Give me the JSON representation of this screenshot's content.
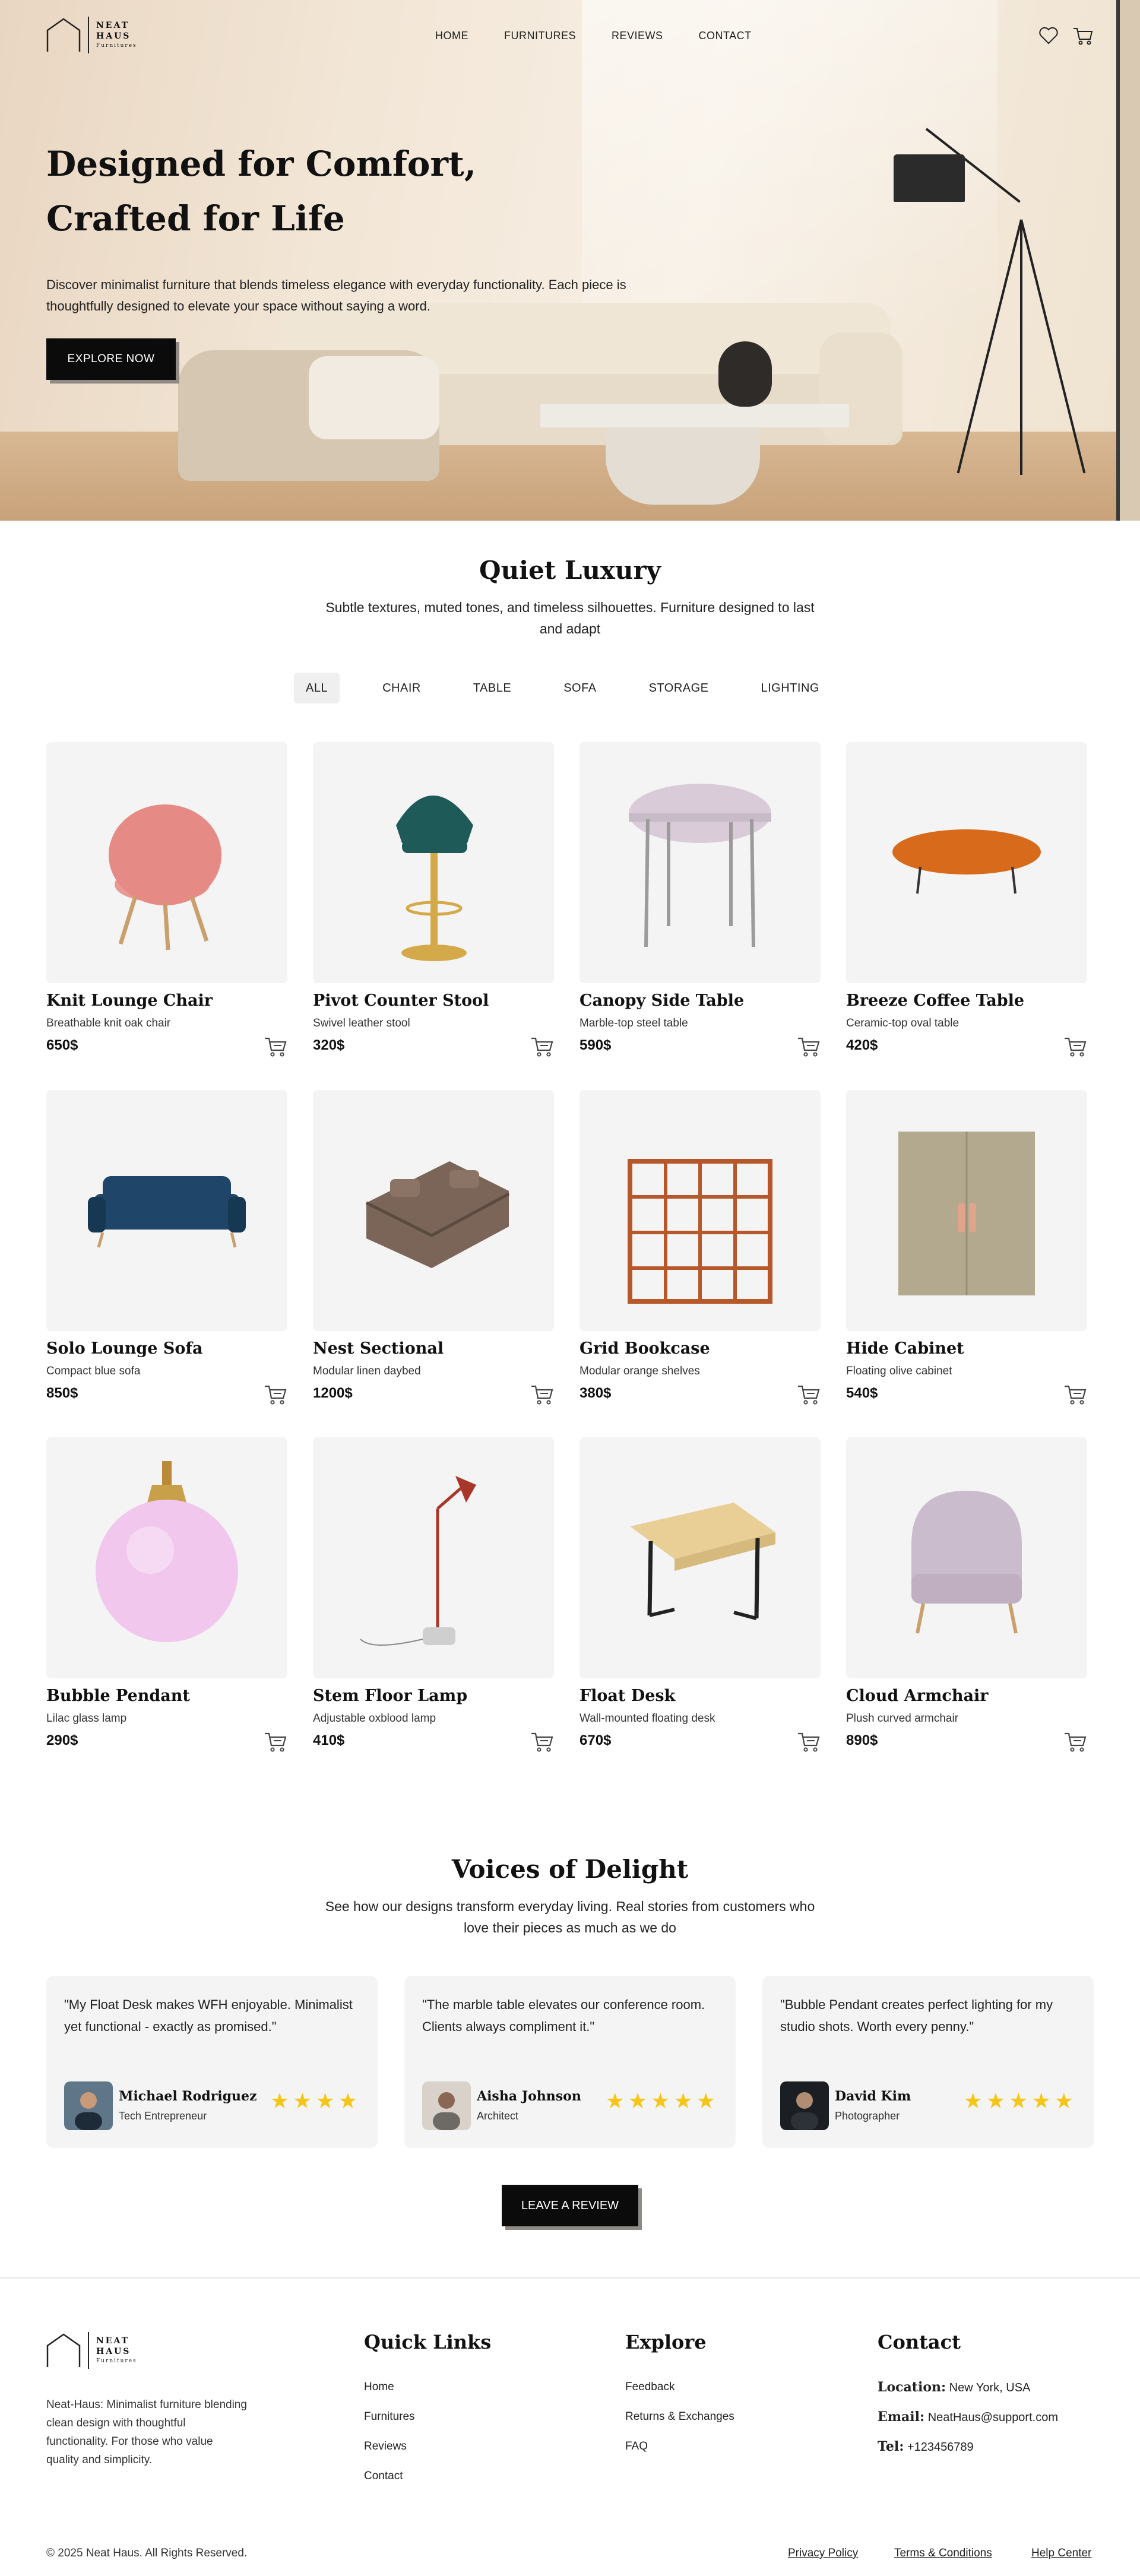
{
  "brand": {
    "name_line1": "NEAT",
    "name_line2": "HAUS",
    "tagline": "Furnitures"
  },
  "nav": {
    "items": [
      "HOME",
      "FURNITURES",
      "REVIEWS",
      "CONTACT"
    ],
    "icons": [
      "heart-icon",
      "cart-icon"
    ]
  },
  "hero": {
    "title_line1": "Designed for Comfort,",
    "title_line2": "Crafted for Life",
    "description": "Discover minimalist furniture that blends timeless elegance with everyday functionality. Each piece is thoughtfully designed to elevate your space without saying a word.",
    "cta": "EXPLORE NOW"
  },
  "collection": {
    "title": "Quiet Luxury",
    "subtitle": "Subtle textures, muted tones, and timeless silhouettes. Furniture designed to last and adapt",
    "filters": [
      "ALL",
      "CHAIR",
      "TABLE",
      "SOFA",
      "STORAGE",
      "LIGHTING"
    ],
    "active_filter": "ALL",
    "products": [
      {
        "name": "Knit Lounge Chair",
        "desc": "Breathable knit oak chair",
        "price": "650$",
        "color": "#e58a84"
      },
      {
        "name": "Pivot Counter Stool",
        "desc": "Swivel leather stool",
        "price": "320$",
        "color": "#1d5a58"
      },
      {
        "name": "Canopy Side Table",
        "desc": "Marble-top steel table",
        "price": "590$",
        "color": "#d9cbd8"
      },
      {
        "name": "Breeze Coffee Table",
        "desc": "Ceramic-top oval table",
        "price": "420$",
        "color": "#d86a1c"
      },
      {
        "name": "Solo Lounge Sofa",
        "desc": "Compact blue sofa",
        "price": "850$",
        "color": "#1f4668"
      },
      {
        "name": "Nest Sectional",
        "desc": "Modular linen daybed",
        "price": "1200$",
        "color": "#7a6558"
      },
      {
        "name": "Grid Bookcase",
        "desc": "Modular orange shelves",
        "price": "380$",
        "color": "#b6582a"
      },
      {
        "name": "Hide Cabinet",
        "desc": "Floating olive cabinet",
        "price": "540$",
        "color": "#b2a98e"
      },
      {
        "name": "Bubble Pendant",
        "desc": "Lilac glass lamp",
        "price": "290$",
        "color": "#f1c7ee"
      },
      {
        "name": "Stem Floor Lamp",
        "desc": "Adjustable oxblood lamp",
        "price": "410$",
        "color": "#a8372a"
      },
      {
        "name": "Float Desk",
        "desc": "Wall-mounted floating desk",
        "price": "670$",
        "color": "#e9cf96"
      },
      {
        "name": "Cloud Armchair",
        "desc": "Plush curved armchair",
        "price": "890$",
        "color": "#cbbccd"
      }
    ]
  },
  "reviews": {
    "title": "Voices of Delight",
    "subtitle": "See how our designs transform everyday living. Real stories from customers who love their pieces as much as we do",
    "items": [
      {
        "quote": "\"My Float Desk makes WFH enjoyable. Minimalist yet functional - exactly as promised.\"",
        "name": "Michael Rodriguez",
        "role": "Tech Entrepreneur",
        "stars": "★★★★"
      },
      {
        "quote": "\"The marble table elevates our conference room. Clients always compliment it.\"",
        "name": "Aisha Johnson",
        "role": "Architect",
        "stars": "★★★★★"
      },
      {
        "quote": "\"Bubble Pendant creates perfect lighting for my studio shots. Worth every penny.\"",
        "name": "David Kim",
        "role": "Photographer",
        "stars": "★★★★★"
      }
    ],
    "cta": "LEAVE A REVIEW"
  },
  "footer": {
    "description": "Neat-Haus: Minimalist furniture blending clean design with thoughtful functionality. For those who value quality and simplicity.",
    "quick_links": {
      "title": "Quick Links",
      "items": [
        "Home",
        "Furnitures",
        "Reviews",
        "Contact"
      ]
    },
    "explore": {
      "title": "Explore",
      "items": [
        "Feedback",
        "Returns & Exchanges",
        "FAQ"
      ]
    },
    "contact": {
      "title": "Contact",
      "location_label": "Location:",
      "location": "New York, USA",
      "email_label": "Email:",
      "email": "NeatHaus@support.com",
      "tel_label": "Tel:",
      "tel": "+123456789"
    },
    "copyright": "© 2025 Neat Haus. All Rights Reserved.",
    "legal": [
      "Privacy Policy",
      "Terms & Conditions",
      "Help Center"
    ]
  }
}
